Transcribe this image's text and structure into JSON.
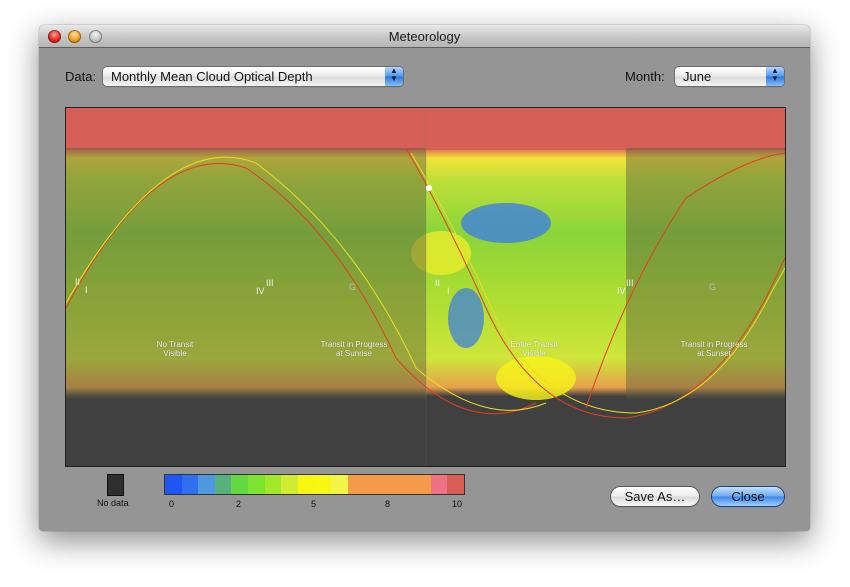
{
  "window": {
    "title": "Meteorology"
  },
  "controls": {
    "data_label": "Data:",
    "data_value": "Monthly Mean Cloud Optical Depth",
    "month_label": "Month:",
    "month_value": "June"
  },
  "map": {
    "regions": [
      {
        "id": "no-transit",
        "line1": "No Transit",
        "line2": "Visible"
      },
      {
        "id": "sunrise",
        "line1": "Transit in Progress",
        "line2": "at Sunrise"
      },
      {
        "id": "entire",
        "line1": "Entire Transit",
        "line2": "Visible"
      },
      {
        "id": "sunset",
        "line1": "Transit in Progress",
        "line2": "at Sunset"
      }
    ],
    "contact_markers": {
      "i": "I",
      "ii": "II",
      "iii": "III",
      "iv": "IV",
      "g": "G"
    }
  },
  "legend": {
    "no_data_label": "No data",
    "no_data_color": "#2e2e2e",
    "colors": [
      "#1f55f5",
      "#2f6ff0",
      "#4d98df",
      "#58b07e",
      "#62d843",
      "#7ce42e",
      "#a2e82a",
      "#d2ea31",
      "#f8f510",
      "#f7f713",
      "#f2f447",
      "#f39b49",
      "#f39b49",
      "#f39b49",
      "#f39b49",
      "#f39b49",
      "#ef7284",
      "#d85e55"
    ],
    "ticks": [
      "0",
      "2",
      "5",
      "8",
      "10"
    ]
  },
  "buttons": {
    "save_as": "Save As…",
    "close": "Close"
  }
}
